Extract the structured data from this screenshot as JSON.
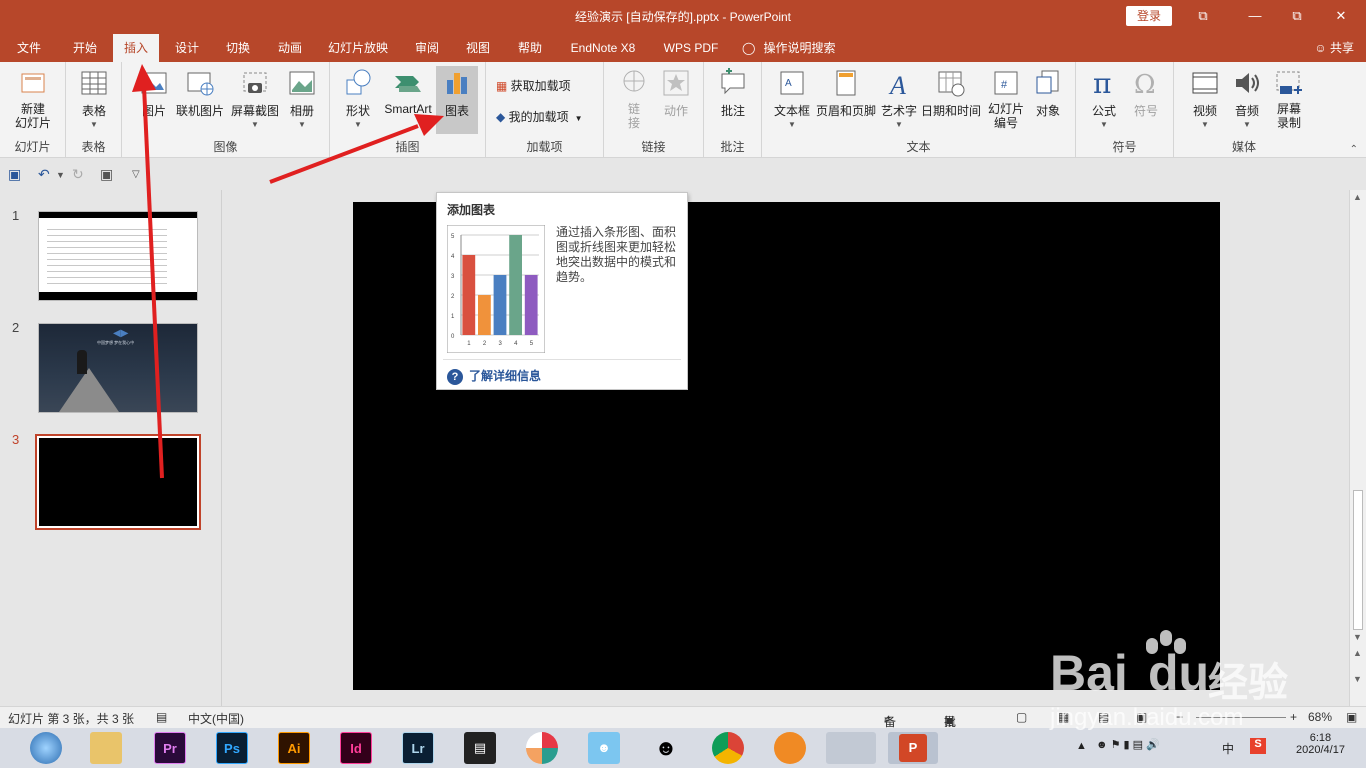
{
  "window": {
    "title": "经验演示 [自动保存的].pptx  -  PowerPoint",
    "login": "登录",
    "minimize": "—",
    "restore": "⧉",
    "close": "✕",
    "restore_icon_left": "⧉"
  },
  "tabs": [
    "文件",
    "开始",
    "插入",
    "设计",
    "切换",
    "动画",
    "幻灯片放映",
    "审阅",
    "视图",
    "帮助",
    "EndNote X8",
    "WPS PDF",
    "操作说明搜索"
  ],
  "active_tab": "插入",
  "share": "共享",
  "ribbon": {
    "new_slide": "新建\n幻灯片",
    "slides_group": "幻灯片",
    "table": "表格",
    "tables_group": "表格",
    "picture": "图片",
    "online_picture": "联机图片",
    "screenshot": "屏幕截图",
    "album": "相册",
    "images_group": "图像",
    "shapes": "形状",
    "smartart": "SmartArt",
    "chart": "图表",
    "illustrations_group": "插图",
    "get_addins": "获取加载项",
    "my_addins": "我的加载项",
    "addins_group": "加载项",
    "link": "链\n接",
    "action": "动作",
    "links_group": "链接",
    "comment": "批注",
    "comments_group": "批注",
    "textbox": "文本框",
    "header_footer": "页眉和页脚",
    "wordart": "艺术字",
    "datetime": "日期和时间",
    "slide_number": "幻灯片\n编号",
    "object": "对象",
    "text_group": "文本",
    "equation": "公式",
    "symbol": "符号",
    "symbols_group": "符号",
    "video": "视频",
    "audio": "音频",
    "screen_recording": "屏幕\n录制",
    "media_group": "媒体"
  },
  "slides": [
    {
      "num": "1"
    },
    {
      "num": "2",
      "caption": "中国梦想  梦在我心中"
    },
    {
      "num": "3"
    }
  ],
  "tooltip": {
    "title": "添加图表",
    "description": "通过插入条形图、面积图或折线图来更加轻松地突出数据中的模式和趋势。",
    "help": "了解详细信息"
  },
  "chart_data": {
    "type": "bar",
    "categories": [
      "1",
      "2",
      "3",
      "4",
      "5"
    ],
    "values": [
      4,
      2,
      3,
      5,
      3
    ],
    "ylim": [
      0,
      5
    ],
    "yticks": [
      "0",
      "1",
      "2",
      "3",
      "4",
      "5"
    ],
    "colors": [
      "#d9503f",
      "#f0923b",
      "#4a7fc1",
      "#6aa58a",
      "#8e5bc0"
    ],
    "grid": true
  },
  "status": {
    "slide_info": "幻灯片 第 3 张，共 3 张",
    "language": "中文(中国)",
    "notes": "备注",
    "comments": "批注",
    "zoom": "68%"
  },
  "taskbar": {
    "apps": [
      "Pr",
      "Ps",
      "Ai",
      "Id",
      "Lr"
    ],
    "time": "6:18",
    "date": "2020/4/17",
    "ime": "中"
  },
  "watermark": {
    "brand": "Bai",
    "brand2": "du",
    "suffix": "经验",
    "url": "jingyan.baidu.com"
  },
  "colors": {
    "accent": "#b7472a",
    "arrow": "#e02020"
  }
}
